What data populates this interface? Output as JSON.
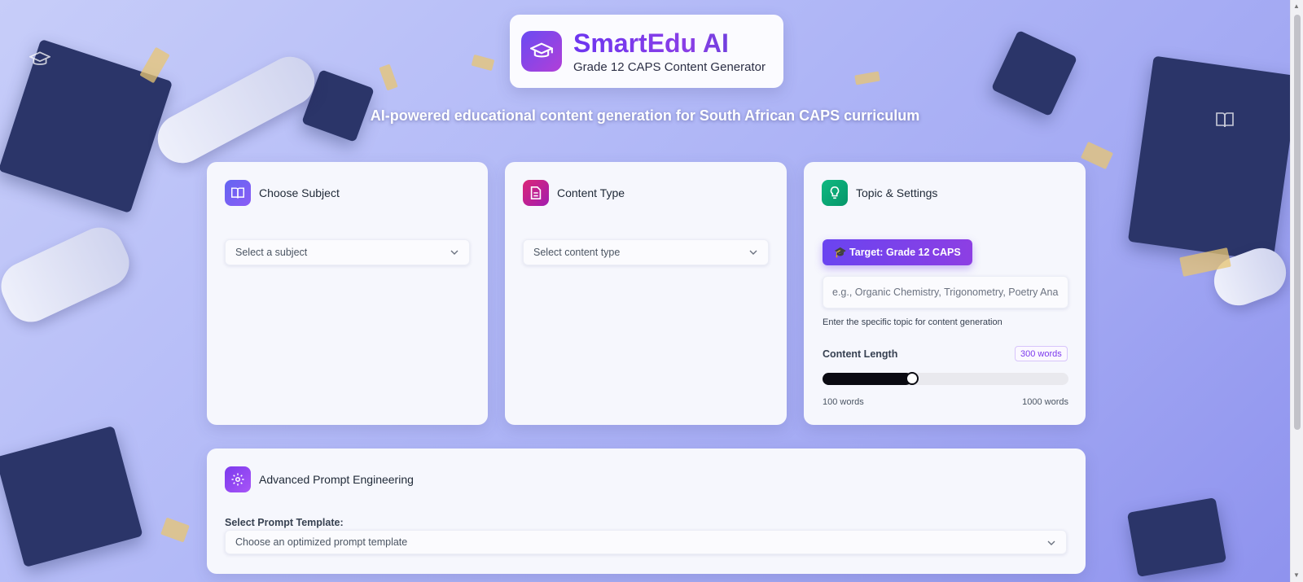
{
  "header": {
    "brand": "SmartEdu AI",
    "subtitle": "Grade 12 CAPS Content Generator",
    "tagline": "AI-powered educational content generation for South African CAPS curriculum"
  },
  "cards": {
    "subject": {
      "title": "Choose Subject",
      "icon": "book-open-icon",
      "placeholder": "Select a subject"
    },
    "content_type": {
      "title": "Content Type",
      "icon": "document-icon",
      "placeholder": "Select content type"
    },
    "topic": {
      "title": "Topic & Settings",
      "icon": "lightbulb-icon",
      "target_label": "🎓 Target: Grade 12 CAPS",
      "topic_placeholder": "e.g., Organic Chemistry, Trigonometry, Poetry Analysis",
      "topic_hint": "Enter the specific topic for content generation",
      "length_label": "Content Length",
      "length_value": "300 words",
      "length_current": 300,
      "length_min": 100,
      "length_max": 1000,
      "min_label": "100 words",
      "max_label": "1000 words"
    }
  },
  "advanced": {
    "title": "Advanced Prompt Engineering",
    "icon": "gear-icon",
    "template_label": "Select Prompt Template:",
    "template_placeholder": "Choose an optimized prompt template"
  },
  "colors": {
    "accent": "#7c3aed",
    "subject_icon": "#6366f1",
    "content_icon": "#db2777",
    "topic_icon": "#10b981"
  }
}
